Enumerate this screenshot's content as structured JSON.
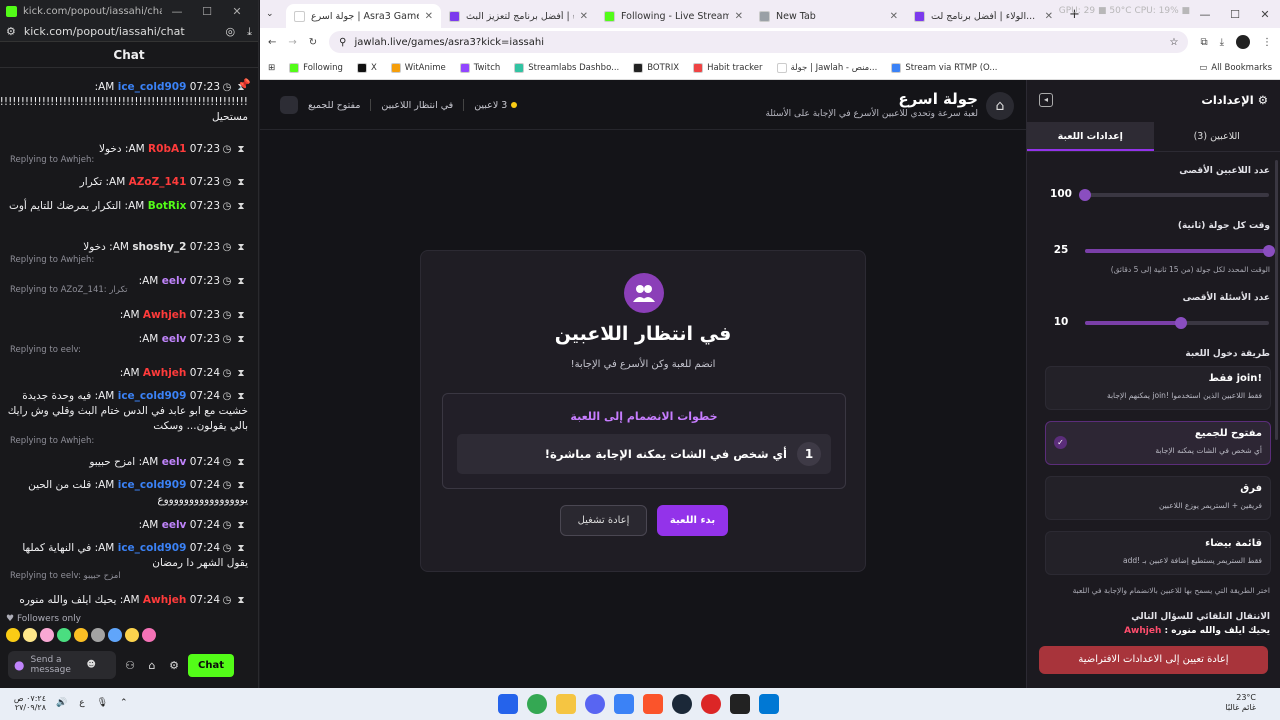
{
  "chat_window": {
    "title": "kick.com/popout/iassahi/chat - Google...",
    "url": "kick.com/popout/iassahi/chat",
    "header": "Chat",
    "messages": [
      {
        "reply": "",
        "time": "07:23 AM",
        "user": "ice_cold909",
        "user_color": "#3b82f6",
        "text": "!!!!!!!!!!!!!!!!!!!!!!!!!!!!!!!!!!!!!!!!!!!!!!!!!!!!!!!!!!!! مستحيل"
      },
      {
        "reply": "",
        "time": "07:23 AM",
        "user": "R0bA1",
        "user_color": "#ff3b3b",
        "text": "دخولا"
      },
      {
        "reply": "Replying to Awhjeh:",
        "time": "07:23 AM",
        "user": "AZoZ_141",
        "user_color": "#ff3b3b",
        "text": "تكرار"
      },
      {
        "reply": "",
        "time": "07:23 AM",
        "user": "BotRix",
        "user_color": "#53fc18",
        "text": "التكرار يمرضك للتايم أوت"
      },
      {
        "reply": "",
        "time": "07:23 AM",
        "user": "shoshy_2",
        "user_color": "#e5e5e5",
        "text": "دخولا"
      },
      {
        "reply": "Replying to Awhjeh:",
        "time": "07:23 AM",
        "user": "eelv",
        "user_color": "#c084fc",
        "text": ""
      },
      {
        "reply": "Replying to AZoZ_141: تكرار",
        "time": "07:23 AM",
        "user": "Awhjeh",
        "user_color": "#ff3b3b",
        "text": ""
      },
      {
        "reply": "",
        "time": "07:23 AM",
        "user": "eelv",
        "user_color": "#c084fc",
        "text": ""
      },
      {
        "reply": "Replying to eelv:",
        "time": "07:24 AM",
        "user": "Awhjeh",
        "user_color": "#ff3b3b",
        "text": ""
      },
      {
        "reply": "",
        "time": "07:24 AM",
        "user": "ice_cold909",
        "user_color": "#3b82f6",
        "text": "فيه وحدة جديدة خشيت مع ابو عابد في الدس ختام البث وقلي وش رايك بالي يقولون... وسكت"
      },
      {
        "reply": "Replying to Awhjeh:",
        "time": "07:24 AM",
        "user": "eelv",
        "user_color": "#c084fc",
        "text": "امزح حبيبو"
      },
      {
        "reply": "",
        "time": "07:24 AM",
        "user": "ice_cold909",
        "user_color": "#3b82f6",
        "text": "قلت من الحين يووووووووووووووووع"
      },
      {
        "reply": "",
        "time": "07:24 AM",
        "user": "eelv",
        "user_color": "#c084fc",
        "text": ""
      },
      {
        "reply": "",
        "time": "07:24 AM",
        "user": "ice_cold909",
        "user_color": "#3b82f6",
        "text": "في النهاية كملها يقول الشهر دا رمضان"
      },
      {
        "reply": "Replying to eelv: امزح حبيبو",
        "time": "07:24 AM",
        "user": "Awhjeh",
        "user_color": "#ff3b3b",
        "text": "يحيك ايلف والله منوره"
      }
    ],
    "followers_only": "Followers only",
    "send_placeholder": "Send a message",
    "chat_button": "Chat"
  },
  "browser": {
    "tabs": [
      {
        "label": "جولة اسرع | Asra3 Game",
        "fav": "#ffffff"
      },
      {
        "label": "الولاء | أفضل برنامج لتعزيز البث",
        "fav": "#7c3aed"
      },
      {
        "label": "Following - Live Streams on Ki",
        "fav": "#53fc18"
      },
      {
        "label": "New Tab",
        "fav": "#9aa0a6"
      },
      {
        "label": "الولاء | أفضل برنامج لت...",
        "fav": "#7c3aed"
      }
    ],
    "sys_stats": "GPU: 29 ■ 50°C   CPU: 19% ■",
    "url": "jawlah.live/games/asra3?kick=iassahi",
    "bookmarks": [
      {
        "label": "Following",
        "color": "#53fc18"
      },
      {
        "label": "X",
        "color": "#111111"
      },
      {
        "label": "WitAnime",
        "color": "#f59e0b"
      },
      {
        "label": "Twitch",
        "color": "#9146ff"
      },
      {
        "label": "Streamlabs Dashbo...",
        "color": "#31c3a2"
      },
      {
        "label": "BOTRIX",
        "color": "#222222"
      },
      {
        "label": "Habit tracker",
        "color": "#ef4444"
      },
      {
        "label": "جولة | Jawlah - منص...",
        "color": "#ffffff"
      },
      {
        "label": "Stream via RTMP (O...",
        "color": "#3b82f6"
      }
    ],
    "all_bookmarks": "All Bookmarks"
  },
  "game": {
    "title": "جولة اسرع",
    "subtitle": "لعبة سرعة وتحدي للاعبين الأسرع في الإجابة على الأسئلة",
    "players_count": "3 لاعبين",
    "status": "في انتظار اللاعبين",
    "access": "مفتوح للجميع",
    "wait_title": "في انتظار اللاعبين",
    "wait_sub": "انضم للعبة وكن الأسرع في الإجابة!",
    "steps_title": "خطوات الانضمام إلى اللعبة",
    "step_number": "1",
    "step_text": "أي شخص في الشات يمكنه الإجابة مباشرة!",
    "start_button": "بدء اللعبة",
    "restart_button": "إعادة تشغيل"
  },
  "settings": {
    "title": "الإعدادات",
    "tab_players": "اللاعبين (3)",
    "tab_game": "إعدادات اللعبة",
    "max_players_label": "عدد اللاعبين الأقصى",
    "max_players_value": "100",
    "max_players_fraction": 0.0,
    "round_time_label": "وقت كل جولة (ثانية)",
    "round_time_value": "25",
    "round_time_fraction": 1.0,
    "round_time_hint": "الوقت المحدد لكل جولة (من 15 ثانية إلى 5 دقائق)",
    "max_questions_label": "عدد الأسئلة الأقصى",
    "max_questions_value": "10",
    "max_questions_fraction": 0.52,
    "entry_label": "طريقة دخول اللعبة",
    "modes": [
      {
        "title": "!join فقط",
        "desc": "فقط اللاعبين الذين استخدموا !join يمكنهم الإجابة",
        "selected": false
      },
      {
        "title": "مفتوح للجميع",
        "desc": "أي شخص في الشات يمكنه الإجابة",
        "selected": true
      },
      {
        "title": "فرق",
        "desc": "فريقين + الستريمر يوزع اللاعبين",
        "selected": false
      },
      {
        "title": "قائمة بيضاء",
        "desc": "فقط الستريمر يستطيع إضافة لاعبين بـ !add",
        "selected": false
      }
    ],
    "entry_hint": "اختر الطريقة التي يسمح بها للاعبين بالانضمام والإجابة في اللعبة",
    "auto_next_label": "الانتقال التلقائي للسؤال التالي",
    "overlay_user": "Awhjeh",
    "overlay_text": "يحيك ايلف والله منوره :",
    "reset_button": "إعادة تعيين إلى الاعدادات الافتراضية"
  },
  "taskbar": {
    "time": "٠٧:٢٤ ص",
    "date": "٢٧/٠٩/٢٨",
    "weather_temp": "23°C",
    "weather_desc": "غائم غالبًا"
  }
}
